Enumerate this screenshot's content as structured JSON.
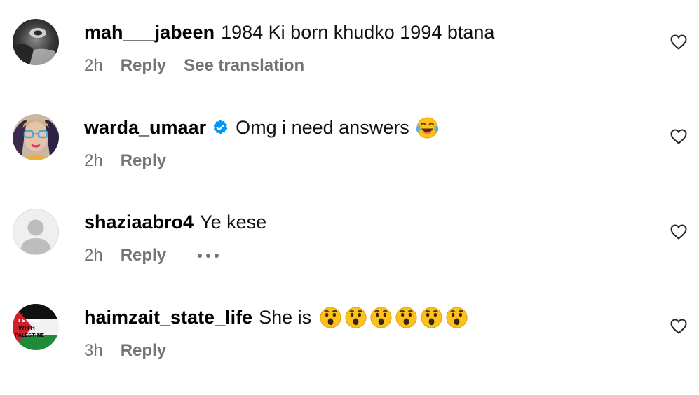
{
  "comments": [
    {
      "username": "mah___jabeen",
      "text": "1984 Ki born khudko 1994 btana",
      "time": "2h",
      "reply_label": "Reply",
      "translate_label": "See translation",
      "verified": false,
      "avatar_icon": "dark-portrait-avatar"
    },
    {
      "username": "warda_umaar",
      "text": "Omg i need answers",
      "time": "2h",
      "reply_label": "Reply",
      "verified": true,
      "emoji": "face-with-tears-of-joy",
      "avatar_icon": "woman-with-glasses-avatar"
    },
    {
      "username": "shaziaabro4",
      "text": "Ye kese",
      "time": "2h",
      "reply_label": "Reply",
      "verified": false,
      "more_icon": "ellipsis-icon",
      "avatar_icon": "default-gray-avatar"
    },
    {
      "username": "haimzait_state_life",
      "text": "She is",
      "time": "3h",
      "reply_label": "Reply",
      "verified": false,
      "emoji": "hushed-face",
      "emoji_count": 6,
      "avatar_icon": "palestine-flag-avatar",
      "avatar_text": [
        "I STAND",
        "WITH",
        "PALESTINE"
      ]
    }
  ],
  "colors": {
    "meta_text": "#737373",
    "verified_blue": "#0095f6",
    "background": "#ffffff"
  }
}
